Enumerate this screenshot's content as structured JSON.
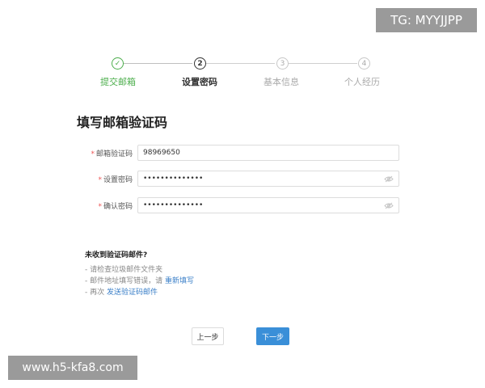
{
  "watermarks": {
    "top": "TG: MYYJJPP",
    "bottom": "www.h5-kfa8.com"
  },
  "stepper": {
    "steps": [
      {
        "number": "✓",
        "label": "提交邮箱",
        "state": "done"
      },
      {
        "number": "2",
        "label": "设置密码",
        "state": "active"
      },
      {
        "number": "3",
        "label": "基本信息",
        "state": "pending"
      },
      {
        "number": "4",
        "label": "个人经历",
        "state": "pending"
      }
    ]
  },
  "title": "填写邮箱验证码",
  "form": {
    "required_mark": "*",
    "fields": [
      {
        "label": "邮箱验证码",
        "value": "98969650",
        "icon": null
      },
      {
        "label": "设置密码",
        "value": "••••••••••••••",
        "icon": "eye-off-icon"
      },
      {
        "label": "确认密码",
        "value": "••••••••••••••",
        "icon": "eye-off-icon"
      }
    ]
  },
  "help": {
    "title": "未收到验证码邮件?",
    "item1": "- 请检查垃圾邮件文件夹",
    "item2_prefix": "- 邮件地址填写错误，请",
    "item2_link": "重新填写",
    "item3_prefix": "- 再次",
    "item3_link": "发送验证码邮件"
  },
  "buttons": {
    "prev": "上一步",
    "next": "下一步"
  },
  "colors": {
    "done": "#4cae4c",
    "primary": "#3a8fd8",
    "link": "#3a7fc8",
    "required": "#e55555"
  }
}
